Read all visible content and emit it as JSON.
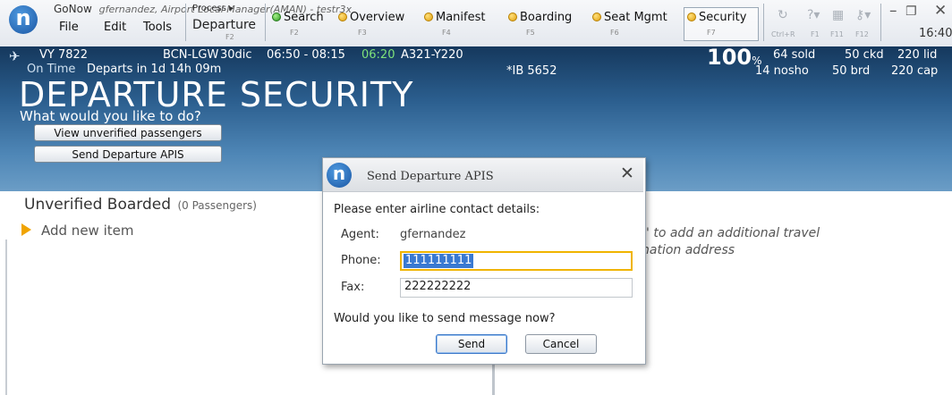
{
  "app": {
    "title": "GoNow",
    "subtitle": "gfernandez, Airport Local Manager(AMAN) - testr3x",
    "logo_letter": "n"
  },
  "menu": {
    "file": "File",
    "edit": "Edit",
    "tools": "Tools"
  },
  "process": {
    "label": "Process ▸",
    "current": "Departure",
    "key": "F2"
  },
  "toolbar": [
    {
      "label": "Search",
      "key": "F2",
      "dot": "green"
    },
    {
      "label": "Overview",
      "key": "F3",
      "dot": "yellow"
    },
    {
      "label": "Manifest",
      "key": "F4",
      "dot": "yellow"
    },
    {
      "label": "Boarding",
      "key": "F5",
      "dot": "yellow"
    },
    {
      "label": "Seat Mgmt",
      "key": "F6",
      "dot": "yellow"
    },
    {
      "label": "Security",
      "key": "F7",
      "dot": "yellow"
    }
  ],
  "shortcut_keys": {
    "refresh": "Ctrl+R",
    "f1": "F1",
    "f11": "F11",
    "f12": "F12"
  },
  "clock": "16:40",
  "flight": {
    "number": "VY 7822",
    "status": "On Time",
    "departs": "Departs in 1d 14h 09m",
    "route": "BCN-LGW",
    "date": "30dic",
    "times": "06:50 - 08:15",
    "est_time": "06:20",
    "aircraft": "A321-Y220",
    "codeshare": "*IB 5652",
    "load_pct": "100",
    "pct_sign": "%",
    "sold": "64 sold",
    "ckd": "50 ckd",
    "lid": "220 lid",
    "nosho": "14 nosho",
    "brd": "50 brd",
    "cap": "220 cap"
  },
  "page": {
    "heading": "DEPARTURE SECURITY",
    "prompt": "What would you like to do?",
    "btn_unverified": "View unverified passengers",
    "btn_send_apis": "Send Departure APIS"
  },
  "list": {
    "title": "Unverified Boarded",
    "count": "(0 Passengers)",
    "add_item": "Add new item"
  },
  "hint": {
    "line1": "-' to add an additional travel",
    "line2": "nation address"
  },
  "dialog": {
    "title": "Send Departure APIS",
    "prompt": "Please enter airline contact details:",
    "agent_label": "Agent:",
    "agent_value": "gfernandez",
    "phone_label": "Phone:",
    "phone_value": "111111111",
    "fax_label": "Fax:",
    "fax_value": "222222222",
    "question": "Would you like to send message now?",
    "send": "Send",
    "cancel": "Cancel"
  },
  "colors": {
    "banner": "#2b5e8e",
    "accent": "#f0b400",
    "selection": "#3a79d1"
  }
}
